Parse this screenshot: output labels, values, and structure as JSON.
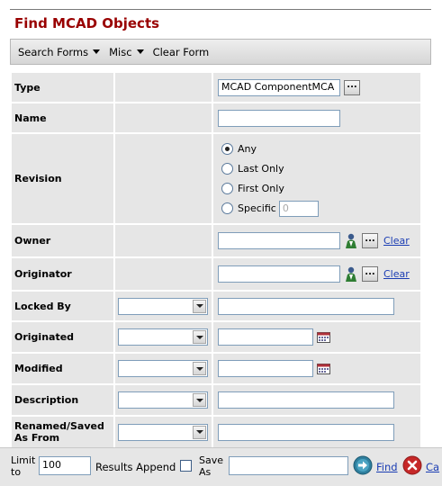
{
  "page": {
    "title": "Find MCAD Objects"
  },
  "toolbar": {
    "search_forms": "Search Forms",
    "misc": "Misc",
    "clear_form": "Clear Form"
  },
  "fields": {
    "type": {
      "label": "Type",
      "value": "MCAD ComponentMCA"
    },
    "name": {
      "label": "Name",
      "value": ""
    },
    "revision": {
      "label": "Revision",
      "options": [
        "Any",
        "Last Only",
        "First Only",
        "Specific"
      ],
      "selected": "Any",
      "specific_placeholder": "0"
    },
    "owner": {
      "label": "Owner",
      "value": "",
      "clear": "Clear"
    },
    "originator": {
      "label": "Originator",
      "value": "",
      "clear": "Clear"
    },
    "locked_by": {
      "label": "Locked By",
      "operator": "",
      "value": ""
    },
    "originated": {
      "label": "Originated",
      "operator": "",
      "value": ""
    },
    "modified": {
      "label": "Modified",
      "operator": "",
      "value": ""
    },
    "description": {
      "label": "Description",
      "operator": "",
      "value": ""
    },
    "renamed": {
      "label": "Renamed/Saved As From",
      "operator": "",
      "value": ""
    }
  },
  "footer": {
    "limit_label": "Limit to",
    "limit_value": "100",
    "results_append": "Results Append",
    "save_as": "Save As",
    "find": "Find",
    "cancel": "Ca"
  },
  "colors": {
    "title": "#990000",
    "link": "#1a3cb3",
    "cell": "#e6e6e6"
  }
}
